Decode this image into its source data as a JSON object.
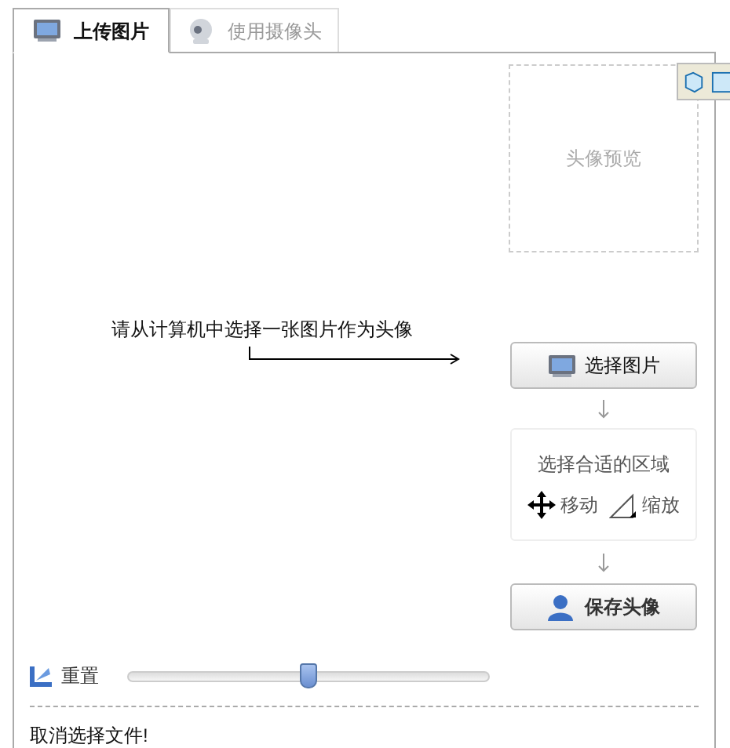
{
  "tabs": [
    {
      "label": "上传图片",
      "kind": "upload",
      "selected": true
    },
    {
      "label": "使用摄像头",
      "kind": "camera",
      "selected": false
    }
  ],
  "preview": {
    "label": "头像预览"
  },
  "instruction": "请从计算机中选择一张图片作为头像",
  "choose_button": "选择图片",
  "region": {
    "title": "选择合适的区域",
    "move": "移动",
    "zoom": "缩放"
  },
  "save_button": "保存头像",
  "reset": {
    "label": "重置"
  },
  "zoom_slider": {
    "level": 0.5
  },
  "status": "取消选择文件!"
}
